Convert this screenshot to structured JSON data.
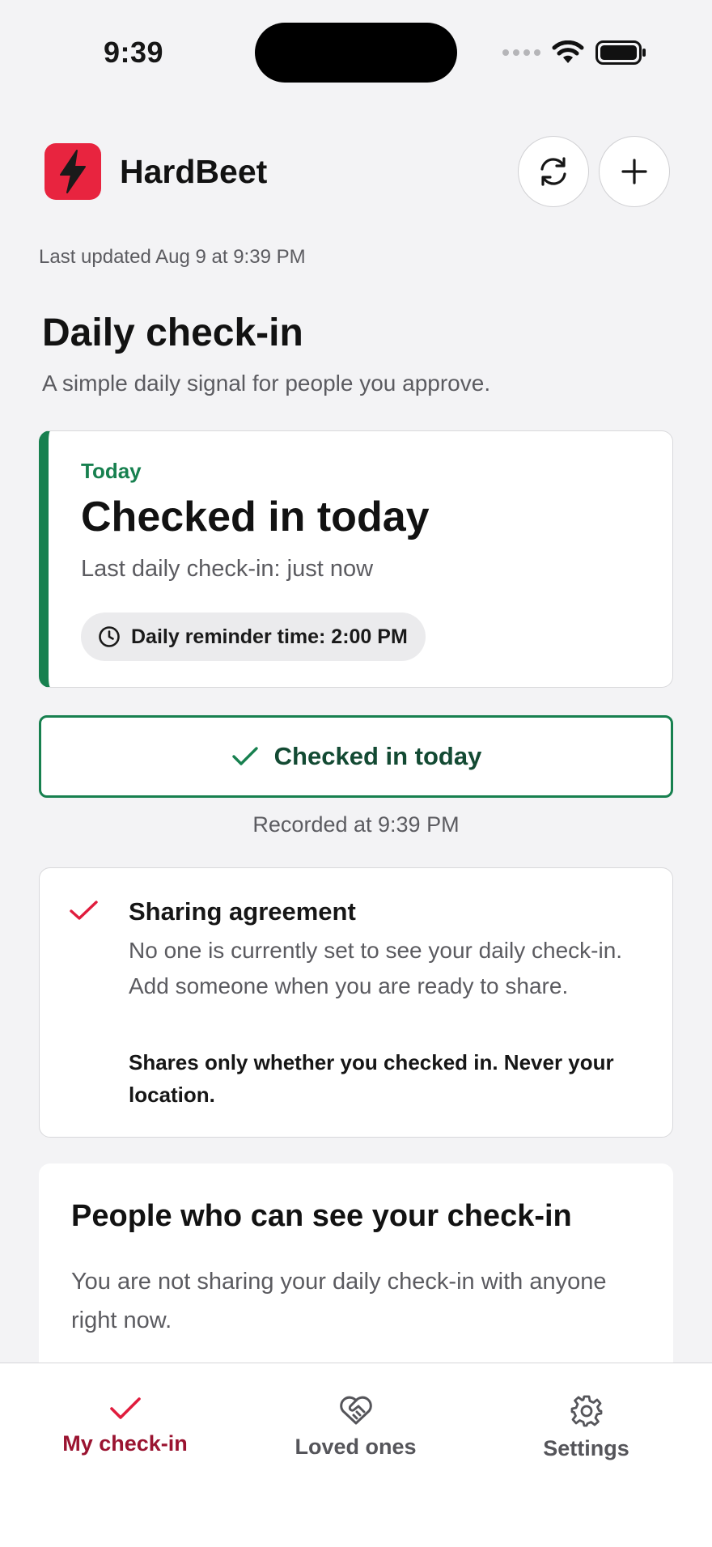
{
  "status_bar": {
    "time": "9:39"
  },
  "header": {
    "app_name": "HardBeet"
  },
  "last_updated": "Last updated Aug 9 at 9:39 PM",
  "page": {
    "title": "Daily check-in",
    "subtitle": "A simple daily signal for people you approve."
  },
  "today_card": {
    "label": "Today",
    "status": "Checked in today",
    "last_checkin": "Last daily check-in: just now",
    "reminder": "Daily reminder time: 2:00 PM"
  },
  "checkin_button": {
    "label": "Checked in today"
  },
  "recorded_at": "Recorded at 9:39 PM",
  "sharing_agreement": {
    "title": "Sharing agreement",
    "body": "No one is currently set to see your daily check-in. Add someone when you are ready to share.",
    "note": "Shares only whether you checked in. Never your location."
  },
  "people": {
    "title": "People who can see your check-in",
    "body": "You are not sharing your daily check-in with anyone right now."
  },
  "tabs": [
    {
      "label": "My check-in",
      "icon": "check-icon",
      "active": true
    },
    {
      "label": "Loved ones",
      "icon": "heart-handshake-icon",
      "active": false
    },
    {
      "label": "Settings",
      "icon": "gear-icon",
      "active": false
    }
  ],
  "colors": {
    "brand": "#e8243f",
    "success": "#17804f",
    "tab_active": "#9a1330"
  }
}
